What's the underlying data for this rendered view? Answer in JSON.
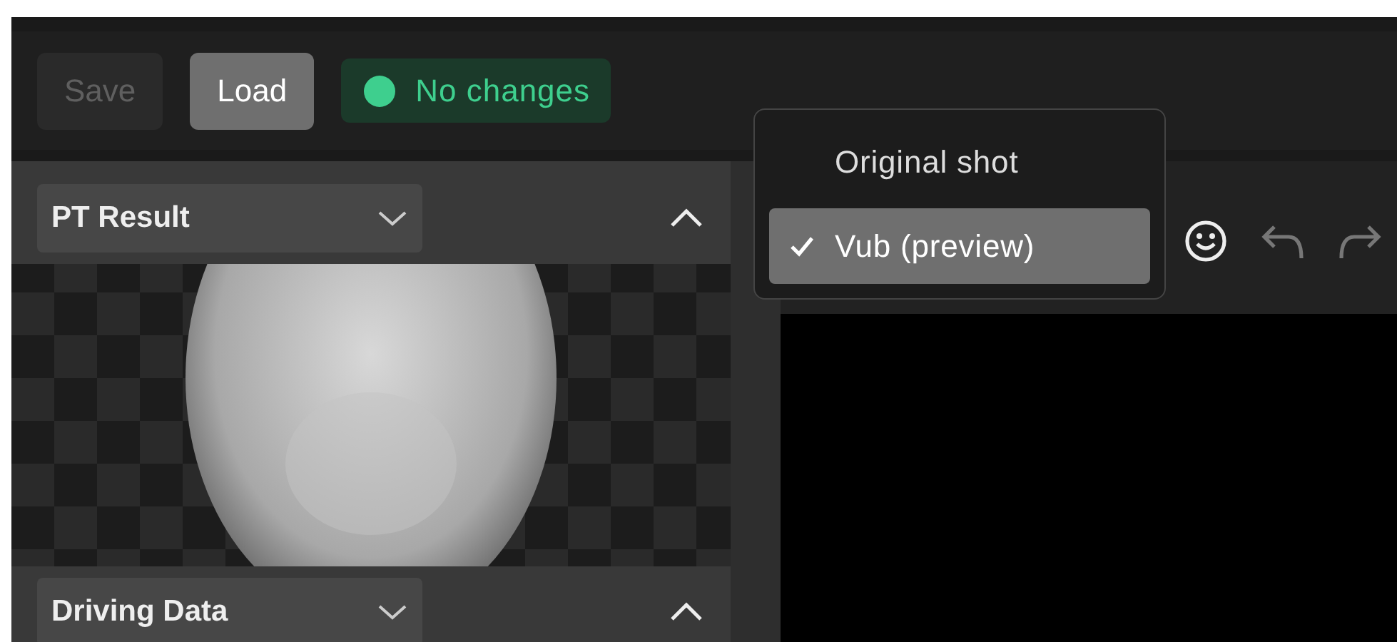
{
  "toolbar": {
    "buttons": [
      {
        "label": "Save",
        "disabled": true
      },
      {
        "label": "Load",
        "disabled": false
      }
    ],
    "status": {
      "label": "No changes"
    }
  },
  "panels": [
    {
      "title": "PT Result",
      "expanded": true
    },
    {
      "title": "Driving Data",
      "expanded": true
    }
  ],
  "view_menu": {
    "items": [
      {
        "label": "Original shot",
        "selected": false
      },
      {
        "label": "Vub (preview)",
        "selected": true
      }
    ]
  }
}
